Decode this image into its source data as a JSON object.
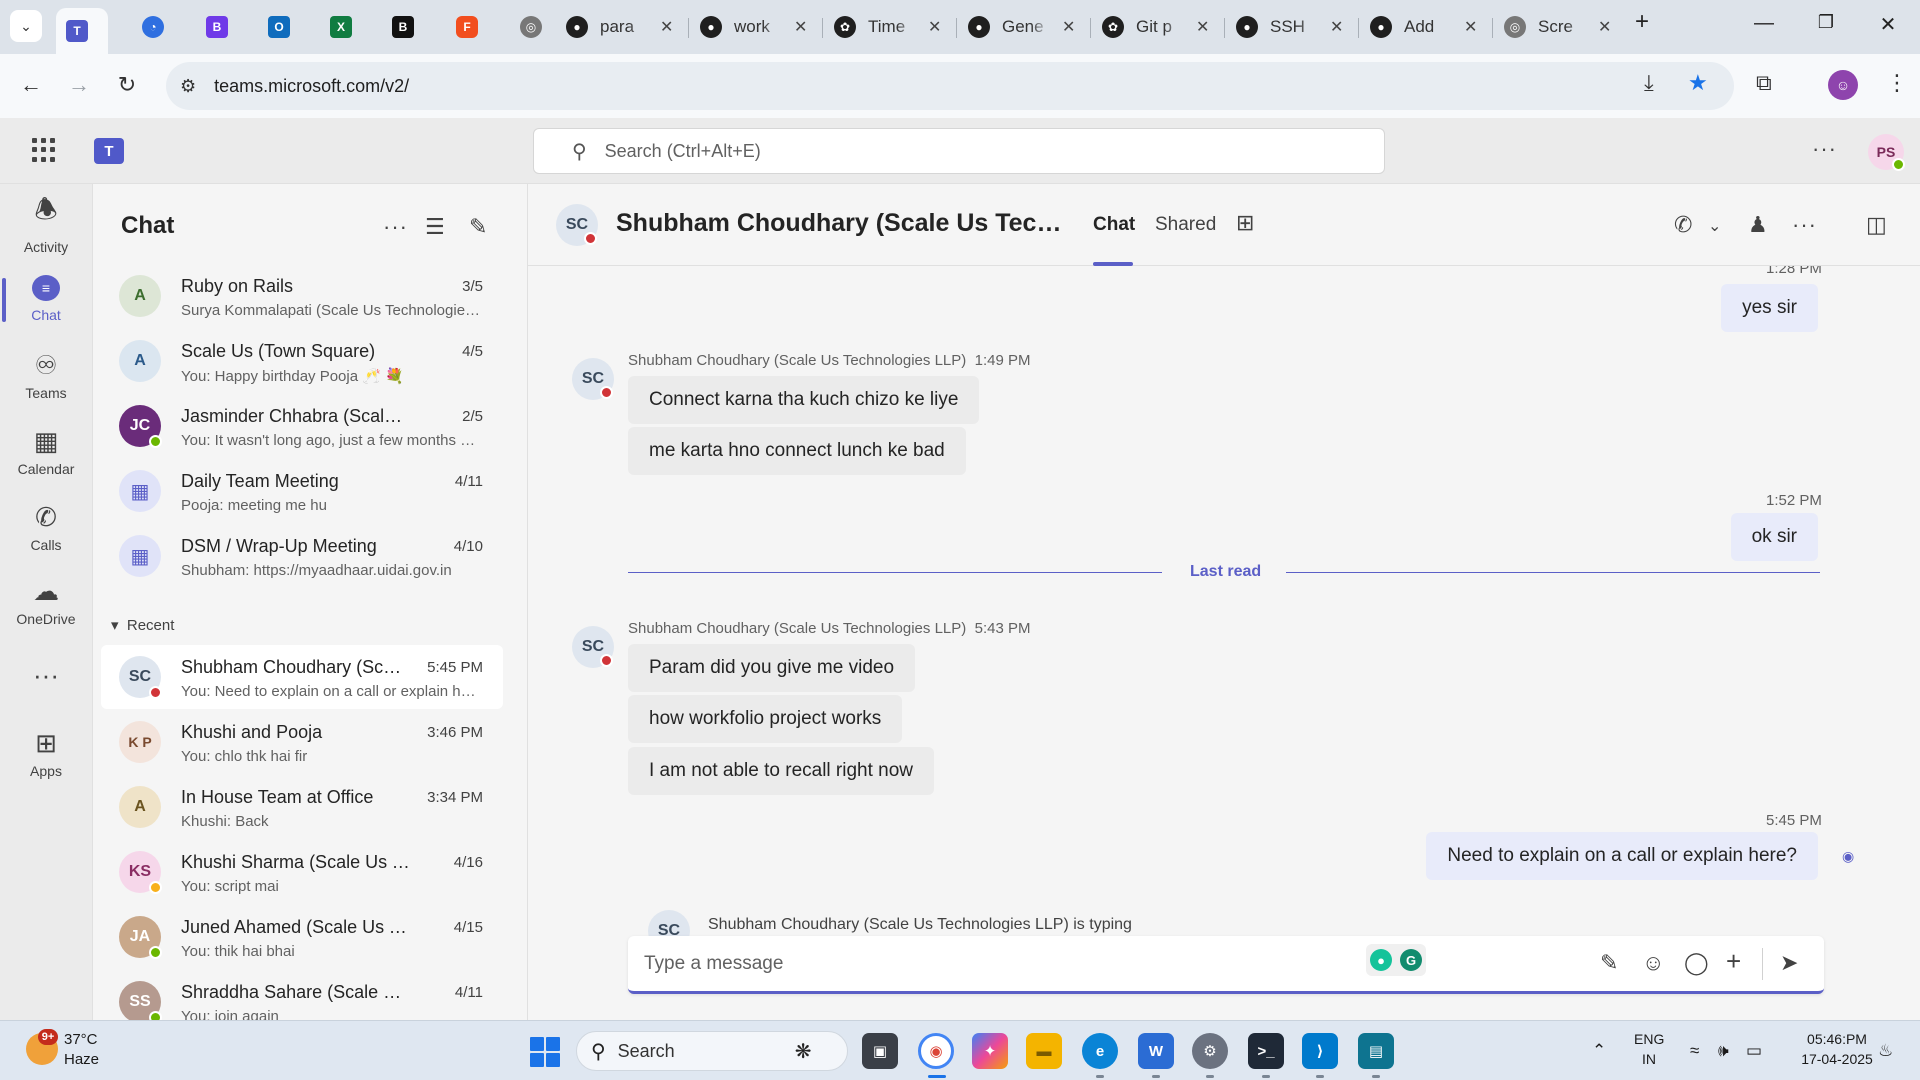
{
  "browser": {
    "tabs": [
      {
        "title": "para",
        "icon": "github-icon"
      },
      {
        "title": "work",
        "icon": "github-icon"
      },
      {
        "title": "Time",
        "icon": "openai-icon"
      },
      {
        "title": "Gene",
        "icon": "github-icon"
      },
      {
        "title": "Git p",
        "icon": "openai-icon"
      },
      {
        "title": "SSH",
        "icon": "github-icon"
      },
      {
        "title": "Add",
        "icon": "github-icon"
      },
      {
        "title": "Scre",
        "icon": "globe-icon"
      }
    ],
    "url": "teams.microsoft.com/v2/"
  },
  "teams": {
    "search_placeholder": "Search (Ctrl+Alt+E)",
    "me_initials": "PS"
  },
  "rail": [
    {
      "label": "Activity",
      "icon": "bell-icon"
    },
    {
      "label": "Chat",
      "icon": "chat-icon"
    },
    {
      "label": "Teams",
      "icon": "teams-icon"
    },
    {
      "label": "Calendar",
      "icon": "calendar-icon"
    },
    {
      "label": "Calls",
      "icon": "phone-icon"
    },
    {
      "label": "OneDrive",
      "icon": "cloud-icon"
    },
    {
      "label": "Apps",
      "icon": "add-apps-icon"
    }
  ],
  "chat_list": {
    "title": "Chat",
    "pinned": [
      {
        "name": "Ruby on Rails",
        "preview": "Surya Kommalapati (Scale Us Technologies LLP)",
        "time": "3/5",
        "avatar": "A"
      },
      {
        "name": "Scale Us (Town Square)",
        "preview": "You: Happy birthday Pooja 🥂 💐",
        "time": "4/5",
        "avatar": "A"
      },
      {
        "name": "Jasminder Chhabra (Scale Us Technologies LLP)",
        "preview": "You: It wasn't long ago, just a few months ago",
        "time": "2/5",
        "avatar": "JC"
      },
      {
        "name": "Daily Team Meeting",
        "preview": "Pooja: meeting me hu",
        "time": "4/11",
        "avatar": "calendar"
      },
      {
        "name": "DSM / Wrap-Up Meeting",
        "preview": "Shubham: https://myaadhaar.uidai.gov.in",
        "time": "4/10",
        "avatar": "calendar"
      }
    ],
    "recent_label": "Recent",
    "recent": [
      {
        "name": "Shubham Choudhary (Scale Us Technologies LLP)",
        "preview": "You: Need to explain on a call or explain here?",
        "time": "5:45 PM",
        "avatar": "SC"
      },
      {
        "name": "Khushi and Pooja",
        "preview": "You: chlo thk hai fir",
        "time": "3:46 PM",
        "avatar": "K P"
      },
      {
        "name": "In House Team at Office",
        "preview": "Khushi: Back",
        "time": "3:34 PM",
        "avatar": "A"
      },
      {
        "name": "Khushi Sharma (Scale Us Technologies LLP)",
        "preview": "You: script mai",
        "time": "4/16",
        "avatar": "KS"
      },
      {
        "name": "Juned Ahamed (Scale Us Technologies LLP)",
        "preview": "You: thik hai bhai",
        "time": "4/15",
        "avatar": "JA"
      },
      {
        "name": "Shraddha Sahare (Scale Us Technologies LLP)",
        "preview": "You: join again",
        "time": "4/11",
        "avatar": "SS"
      }
    ]
  },
  "conversation": {
    "initials": "SC",
    "title": "Shubham Choudhary (Scale Us Technologies LLP)",
    "tabs": {
      "chat": "Chat",
      "shared": "Shared"
    },
    "messages": {
      "out1_time": "1:28 PM",
      "out1_text": "yes sir",
      "in1_sender": "Shubham Choudhary (Scale Us Technologies LLP)",
      "in1_time": "1:49 PM",
      "in1_texts": [
        "Connect karna tha kuch chizo ke liye",
        "me karta hno connect lunch ke bad"
      ],
      "out2_time": "1:52 PM",
      "out2_text": "ok sir",
      "last_read": "Last read",
      "in2_sender": "Shubham Choudhary (Scale Us Technologies LLP)",
      "in2_time": "5:43 PM",
      "in2_texts": [
        "Param did you give me video",
        "how workfolio project works",
        "I am not able to recall right now"
      ],
      "out3_time": "5:45 PM",
      "out3_text": "Need to explain on a call or explain here?"
    },
    "typing": "Shubham Choudhary (Scale Us Technologies LLP) is typing",
    "composer_placeholder": "Type a message"
  },
  "taskbar": {
    "temp": "37°C",
    "condition": "Haze",
    "badge": "9+",
    "search_label": "Search",
    "lang_top": "ENG",
    "lang_bottom": "IN",
    "time": "05:46:PM",
    "date": "17-04-2025"
  },
  "colors": {
    "brand": "#5b5fc7",
    "outgoing_bubble": "#e8ebfa",
    "incoming_bubble": "#ebebeb"
  }
}
